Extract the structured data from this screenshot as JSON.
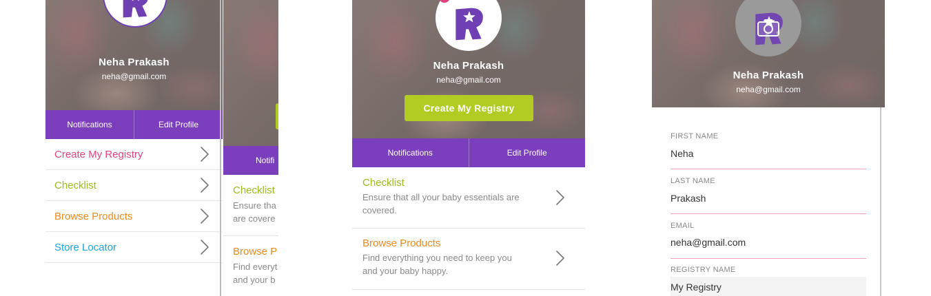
{
  "colors": {
    "purple": "#7b3fbd",
    "pink": "#e2427f",
    "green": "#9cbb1c",
    "orange": "#ef8a1d",
    "blue": "#1aa6df",
    "cta_green": "#b2cc24",
    "field_line": "#f0a1bb"
  },
  "profile": {
    "name": "Neha Prakash",
    "email": "neha@gmail.com",
    "logo_icon": "toysrus-star-logo",
    "camera_icon": "camera-icon"
  },
  "tabs": {
    "notifications": "Notifications",
    "edit_profile": "Edit Profile",
    "notifications_clipped": "Notifi"
  },
  "screen1": {
    "menu": [
      {
        "label": "Create My Registry",
        "color": "#e2427f"
      },
      {
        "label": "Checklist",
        "color": "#9cbb1c"
      },
      {
        "label": "Browse Products",
        "color": "#ef8a1d"
      },
      {
        "label": "Store Locator",
        "color": "#1aa6df"
      }
    ]
  },
  "screen2": {
    "cards": [
      {
        "title": "Checklist",
        "desc1": "Ensure tha",
        "desc2": "are covere"
      },
      {
        "title": "Browse P",
        "desc1": "Find everyt",
        "desc2": "and your b"
      }
    ]
  },
  "screen3": {
    "cta": "Create My Registry",
    "cards": [
      {
        "title": "Checklist",
        "desc": "Ensure that all your baby essentials are covered.",
        "color": "#9cbb1c"
      },
      {
        "title": "Browse Products",
        "desc": "Find everything you need to keep you and your baby happy.",
        "color": "#ef8a1d"
      }
    ]
  },
  "screen4": {
    "fields": [
      {
        "label": "FIRST NAME",
        "value": "Neha"
      },
      {
        "label": "LAST NAME",
        "value": "Prakash"
      },
      {
        "label": "EMAIL",
        "value": "neha@gmail.com"
      },
      {
        "label": "REGISTRY NAME",
        "value": "My Registry"
      }
    ]
  }
}
